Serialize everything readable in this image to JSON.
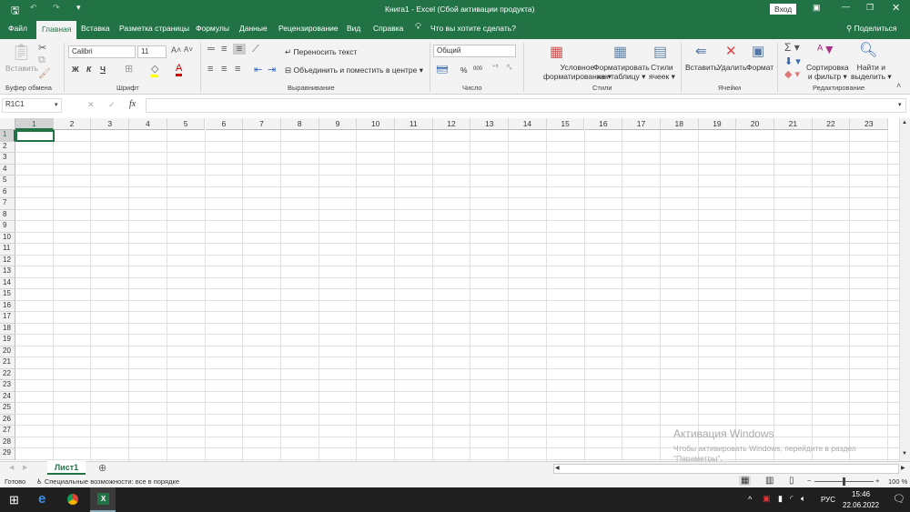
{
  "title": "Книга1  -  Excel (Сбой активации продукта)",
  "signin": "Вход",
  "tabs": [
    "Файл",
    "Главная",
    "Вставка",
    "Разметка страницы",
    "Формулы",
    "Данные",
    "Рецензирование",
    "Вид",
    "Справка"
  ],
  "tell_me": "Что вы хотите сделать?",
  "share": "Поделиться",
  "ribbon": {
    "paste": "Вставить",
    "font_name": "Calibri",
    "font_size": "11",
    "bold": "Ж",
    "italic": "К",
    "underline": "Ч",
    "wrap": "Переносить текст",
    "merge": "Объединить и поместить в центре",
    "number_format": "Общий",
    "percent": "%",
    "thousands": "000",
    "cond_fmt": [
      "Условное",
      "форматирование"
    ],
    "fmt_table": [
      "Форматировать",
      "как таблицу"
    ],
    "cell_styles": [
      "Стили",
      "ячеек"
    ],
    "insert": "Вставить",
    "delete": "Удалить",
    "format": "Формат",
    "sort": [
      "Сортировка",
      "и фильтр"
    ],
    "find": [
      "Найти и",
      "выделить"
    ],
    "groups": [
      "Буфер обмена",
      "Шрифт",
      "Выравнивание",
      "Число",
      "Стили",
      "Ячейки",
      "Редактирование"
    ]
  },
  "name_box": "R1C1",
  "formula": "",
  "columns": [
    "1",
    "2",
    "3",
    "4",
    "5",
    "6",
    "7",
    "8",
    "9",
    "10",
    "11",
    "12",
    "13",
    "14",
    "15",
    "16",
    "17",
    "18",
    "19",
    "20",
    "21",
    "22",
    "23"
  ],
  "rows": [
    "1",
    "2",
    "3",
    "4",
    "5",
    "6",
    "7",
    "8",
    "9",
    "10",
    "11",
    "12",
    "13",
    "14",
    "15",
    "16",
    "17",
    "18",
    "19",
    "20",
    "21",
    "22",
    "23",
    "24",
    "25",
    "26",
    "27",
    "28",
    "29"
  ],
  "sheet": "Лист1",
  "status": "Готово",
  "accessibility": "Специальные возможности: все в порядке",
  "zoom": "100 %",
  "watermark": [
    "Активация Windows",
    "Чтобы активировать Windows, перейдите в раздел",
    "\"Параметры\"."
  ],
  "taskbar": {
    "lang": "РУС",
    "time": "15:46",
    "date": "22.06.2022"
  },
  "colors": {
    "accent": "#217346"
  }
}
